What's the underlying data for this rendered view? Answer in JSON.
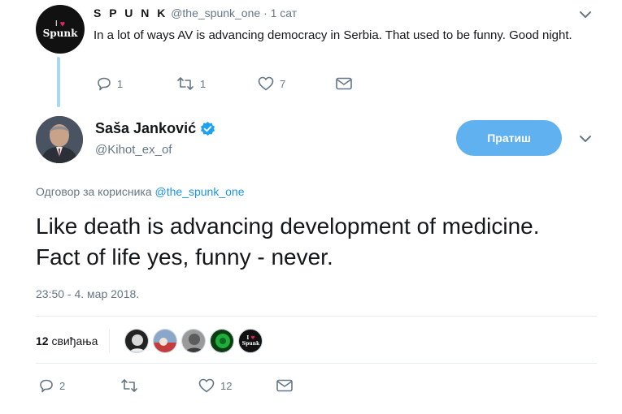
{
  "parent_tweet": {
    "author_name": "S P U N K",
    "handle": "@the_spunk_one",
    "separator": "·",
    "time": "1 сат",
    "text": "In a lot of ways AV is advancing democracy in Serbia. That used to be funny. Good night.",
    "avatar_text": "Spunk",
    "reply_count": "1",
    "retweet_count": "1",
    "like_count": "7"
  },
  "main_tweet": {
    "author_name": "Saša Janković",
    "handle": "@Kihot_ex_of",
    "follow_label": "Пратиш",
    "reply_to_prefix": "Одговор за корисника",
    "reply_to_mention": "@the_spunk_one",
    "text": "Like death is advancing development of medicine. Fact of life yes, funny - never.",
    "timestamp": "23:50 - 4. мар 2018.",
    "likes_count": "12",
    "likes_label": "свиђања",
    "reply_count": "2",
    "retweet_count": "",
    "like_count": "12"
  },
  "colors": {
    "accent": "#1b95e0",
    "follow_button": "#5fb2ef",
    "muted_text": "#657786",
    "thread_line": "#a8d8f0",
    "verified": "#1da1f2"
  },
  "icons": [
    "reply-icon",
    "retweet-icon",
    "like-icon",
    "message-icon",
    "chevron-down-icon",
    "verified-badge-icon",
    "heart-icon"
  ]
}
